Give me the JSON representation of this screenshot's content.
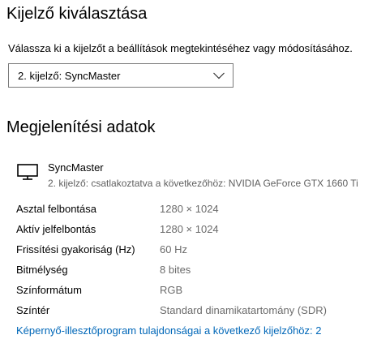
{
  "select_display": {
    "title": "Kijelző kiválasztása",
    "instruction": "Válassza ki a kijelzőt a beállítások megtekintéséhez vagy módosításához.",
    "dropdown_value": "2. kijelző: SyncMaster",
    "dropdown_icon": "chevron-down-icon"
  },
  "display_info": {
    "title": "Megjelenítési adatok",
    "icon": "monitor-icon",
    "monitor_name": "SyncMaster",
    "monitor_description": "2. kijelző: csatlakoztatva a következőhöz: NVIDIA GeForce GTX 1660 Ti",
    "properties": [
      {
        "label": "Asztal felbontása",
        "value": "1280 × 1024"
      },
      {
        "label": "Aktív jelfelbontás",
        "value": "1280 × 1024"
      },
      {
        "label": "Frissítési gyakoriság (Hz)",
        "value": "60 Hz"
      },
      {
        "label": "Bitmélység",
        "value": "8 bites"
      },
      {
        "label": "Színformátum",
        "value": "RGB"
      },
      {
        "label": "Színtér",
        "value": "Standard dinamikatartomány (SDR)"
      }
    ],
    "adapter_link": "Képernyő-illesztőprogram tulajdonságai a következő kijelzőhöz: 2"
  },
  "colors": {
    "link": "#0067b8",
    "secondary_text": "#6b6b6b",
    "border": "#7a7a7a"
  }
}
